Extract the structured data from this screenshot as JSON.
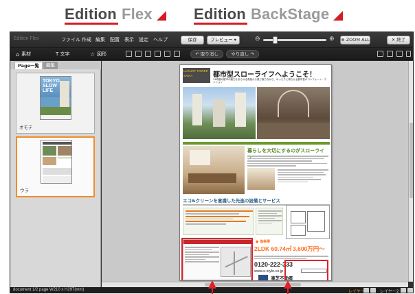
{
  "brand": {
    "flex_word1": "Edition",
    "flex_word2": "Flex",
    "backstage_word1": "Edition",
    "backstage_word2": "BackStage",
    "accent_color": "#d41c24"
  },
  "menubar": {
    "app_name": "Edition Flex",
    "items": [
      "ファイル",
      "作成",
      "編集",
      "配置",
      "表示",
      "設定",
      "ヘルプ"
    ],
    "save_label": "保存",
    "preview_label": "プレビュー ▾",
    "zoom_all_label": "ZOOM ALL",
    "close_label": "✕ 終了"
  },
  "toolbar": {
    "material_label": "素材",
    "text_label": "T 文字",
    "shape_label": "図形",
    "undo_label": "取り消し",
    "redo_label": "やり直し"
  },
  "left_panel": {
    "tab_active": "Page一覧",
    "tab_inactive": "編集",
    "pages": [
      {
        "label": "オモテ",
        "thumb_text": "TOKYO SLOW LIFE"
      },
      {
        "label": "ウラ",
        "thumb_text": ""
      }
    ]
  },
  "document": {
    "logo_text": "LUXURY TOWER SAIKA",
    "title": "都市型スローライフへようこそ！",
    "subtitle": "24時間の都市の魅力をあらゆる角度から感じ取りながら、ゆったりと暮らせる都市型のコンフォート・マンション",
    "section1_heading": "暮らしを大切にするのがスローライフ",
    "section2_heading": "エコ&クリーンを意識した先進の設備とサービス",
    "price_label": "● 価格帯",
    "price_area": "2LDK 60.74㎡",
    "price_value": "3,600万円〜",
    "phone": "0120-222-333",
    "url": "www.s-style.co.jp",
    "company": "湊芝不動産"
  },
  "statusbar": {
    "doc_info": "document 1/2 page W210 x H297(mm)",
    "layer1": "レイヤー1",
    "layer2": "レイヤー2"
  }
}
